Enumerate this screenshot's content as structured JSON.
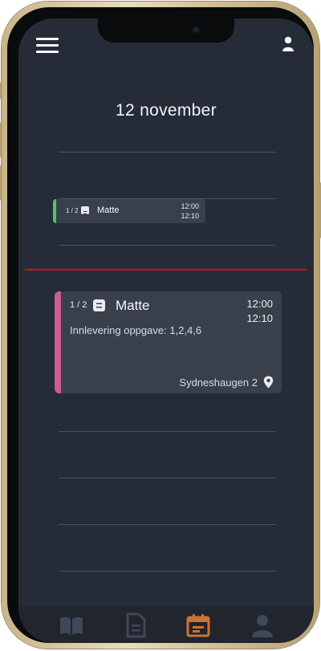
{
  "header": {
    "date": "12 november"
  },
  "events": [
    {
      "fraction": "1 / 2",
      "subject": "Matte",
      "start": "12:00",
      "end": "12:10",
      "color": "#4cc76a"
    },
    {
      "fraction": "1 / 2",
      "subject": "Matte",
      "start": "12:00",
      "end": "12:10",
      "description": "Innlevering oppgave: 1,2,4,6",
      "location": "Sydneshaugen 2",
      "color": "#cd5a93"
    }
  ],
  "current_time_line_color": "#d10f1a",
  "tabbar": {
    "items": [
      {
        "icon": "book-icon"
      },
      {
        "icon": "document-icon"
      },
      {
        "icon": "calendar-icon",
        "active": true,
        "color": "#d0722f"
      },
      {
        "icon": "person-icon"
      }
    ]
  },
  "colors": {
    "background": "#262c37",
    "card": "#39404c",
    "accent": "#d0722f"
  }
}
